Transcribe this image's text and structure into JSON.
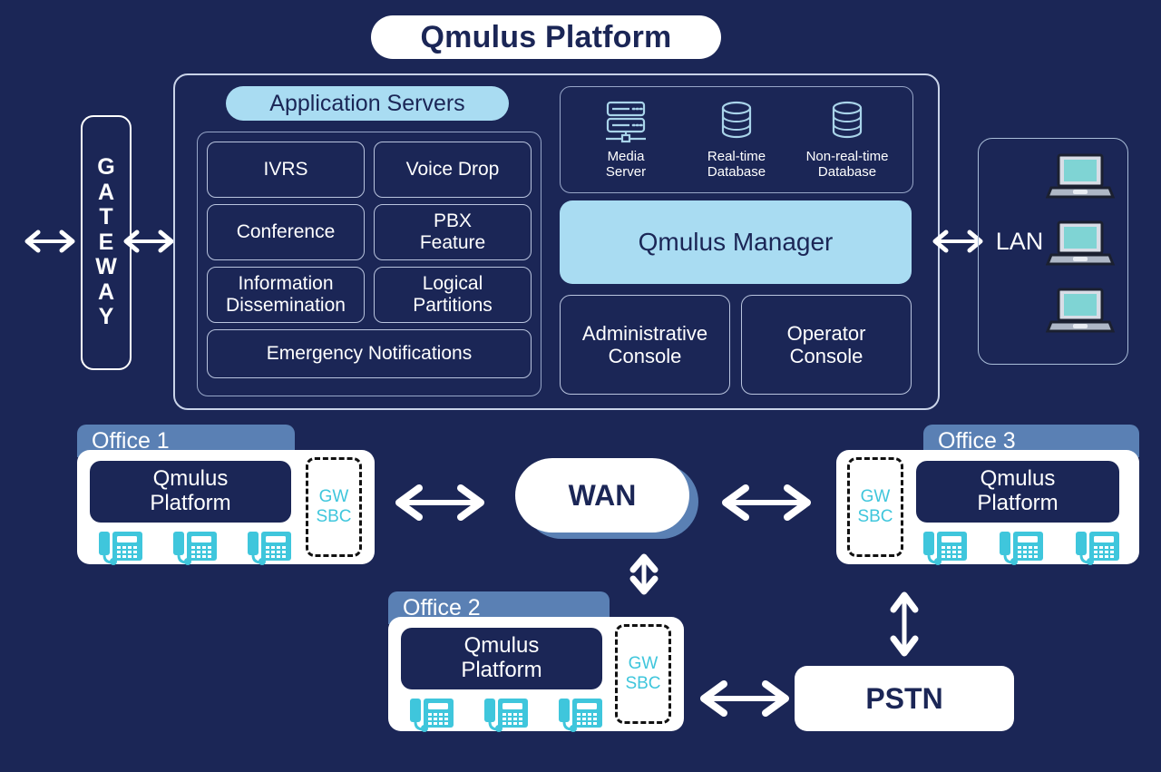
{
  "title": {
    "label": "Qmulus Platform"
  },
  "gateway": {
    "label": "G\nA\nT\nE\nW\nA\nY",
    "name": "GATEWAY"
  },
  "platform": {
    "application_servers": {
      "badge_label": "Application Servers",
      "cells": [
        {
          "label": "IVRS"
        },
        {
          "label": "Voice Drop"
        },
        {
          "label": "Conference"
        },
        {
          "label": "PBX\nFeature"
        },
        {
          "label": "Information\nDissemination"
        },
        {
          "label": "Logical\nPartitions"
        },
        {
          "label": "Emergency Notifications"
        }
      ]
    },
    "infrastructure_icons": [
      {
        "icon": "media-server-icon",
        "label": "Media\nServer"
      },
      {
        "icon": "database-icon",
        "label": "Real-time\nDatabase"
      },
      {
        "icon": "database-icon",
        "label": "Non-real-time\nDatabase"
      }
    ],
    "manager": {
      "label": "Qmulus Manager"
    },
    "consoles": [
      {
        "label": "Administrative\nConsole"
      },
      {
        "label": "Operator\nConsole"
      }
    ]
  },
  "lan": {
    "label": "LAN",
    "devices": [
      {
        "icon": "laptop-icon"
      },
      {
        "icon": "laptop-icon"
      },
      {
        "icon": "laptop-icon"
      }
    ]
  },
  "offices": [
    {
      "header": "Office 1",
      "platform_label": "Qmulus\nPlatform",
      "gw_sbc_label": "GW\nSBC",
      "phones": [
        "phone-icon",
        "phone-icon",
        "phone-icon"
      ]
    },
    {
      "header": "Office 2",
      "platform_label": "Qmulus\nPlatform",
      "gw_sbc_label": "GW\nSBC",
      "phones": [
        "phone-icon",
        "phone-icon",
        "phone-icon"
      ]
    },
    {
      "header": "Office 3",
      "platform_label": "Qmulus\nPlatform",
      "gw_sbc_label": "GW\nSBC",
      "phones": [
        "phone-icon",
        "phone-icon",
        "phone-icon"
      ]
    }
  ],
  "networks": {
    "wan": {
      "label": "WAN"
    },
    "pstn": {
      "label": "PSTN"
    }
  },
  "colors": {
    "background": "#1b2656",
    "accent_light_blue": "#a9dcf2",
    "office_header": "#5a80b4",
    "teal": "#3fc6dc",
    "white": "#ffffff",
    "border_light": "#c9d3e8"
  }
}
